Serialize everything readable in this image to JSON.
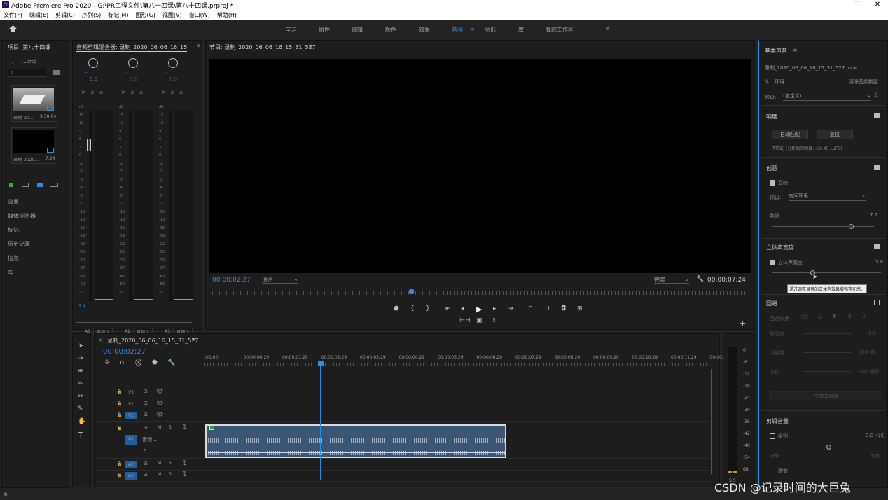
{
  "window": {
    "title": "Adobe Premiere Pro 2020 - G:\\PR工程文件\\第八十四课\\第八十四课.prproj *",
    "logo": "Pr",
    "minimize": "─",
    "maximize": "☐",
    "close": "✕"
  },
  "menu": [
    "文件(F)",
    "编辑(E)",
    "剪辑(C)",
    "序列(S)",
    "标记(M)",
    "图形(G)",
    "视图(V)",
    "窗口(W)",
    "帮助(H)"
  ],
  "workspace": {
    "tabs": [
      "学习",
      "组件",
      "编辑",
      "颜色",
      "效果",
      "音频",
      "图形",
      "库",
      "我的工作区"
    ],
    "active": "音频",
    "more": "»"
  },
  "project": {
    "title": "项目: 第八十四课",
    "file": "...proj",
    "items": [
      {
        "name": "录制_20...",
        "dur": "9:58:04"
      },
      {
        "name": "录制_2020...",
        "dur": "7:24"
      }
    ],
    "panels": [
      "效果",
      "媒体浏览器",
      "标记",
      "历史记录",
      "信息",
      "库"
    ]
  },
  "mixer": {
    "title": "音频剪辑混合器: 录制_2020_06_06_16_15",
    "lr": "L",
    "channels": [
      {
        "value": "0.0",
        "track": "A1",
        "name": "音频 1",
        "peak": "3.4"
      },
      {
        "value": "0.0",
        "track": "A2",
        "name": "音频 2",
        "peak": ""
      },
      {
        "value": "0.0",
        "track": "A3",
        "name": "音频 3",
        "peak": ""
      }
    ],
    "scale": [
      "dB",
      "15",
      "12",
      "9",
      "6",
      "3",
      "0",
      "-1",
      "-2",
      "-3",
      "-4",
      "-5",
      "-7",
      "-10",
      "-13",
      "-15",
      "-19",
      "-22",
      "-25",
      "-30",
      "-37",
      "-43",
      "-50",
      "-∞"
    ],
    "msb": [
      "M",
      "S",
      "⊙"
    ]
  },
  "program": {
    "title": "节目: 录制_2020_06_06_16_15_31_527",
    "timecode": "00;00;02;27",
    "fit": "适合",
    "quality": "完整",
    "duration": "00;00;07;24"
  },
  "timeline": {
    "tab": "录制_2020_06_06_16_15_31_527",
    "timecode": "00;00;02;27",
    "ruler": [
      ";00;00",
      "00;00;00;29",
      "00;00;01;29",
      "00;00;02;29",
      "00;00;03;29",
      "00;00;04;29",
      "00;00;05;29",
      "00;00;06;29",
      "00;00;07;29",
      "00;00;08;29",
      "00;00;09;29",
      "00;00;10;29",
      "00;00;11;29",
      "00;00;1"
    ],
    "tracks": [
      "V3",
      "V2",
      "V1",
      "A1",
      "A2",
      "A3"
    ],
    "a1name": "音频 1",
    "a1vol": "0.",
    "meterlabels": [
      "0",
      "-6",
      "-12",
      "-18",
      "-24",
      "-30",
      "-36",
      "-42",
      "-48",
      "-54",
      "dB"
    ],
    "ss": "S S"
  },
  "essential": {
    "title": "基本声音",
    "file": "录制_2020_06_06_16_15_31_527.mp4",
    "type": "环境",
    "clear": "清除音频类型",
    "preset_label": "预设:",
    "preset": "(自定义)",
    "loudness": "响度",
    "auto": "自动匹配",
    "reset": "复位",
    "loud_note": "不匹配 (分析后的响度: -30.45 LUFS)",
    "creative": "创意",
    "reverb": "混响",
    "reverb_preset_label": "预设:",
    "reverb_preset": "房间环境",
    "amount": "数量",
    "amount_val": "7.7",
    "stereo": "立体声宽度",
    "stereo_chk": "立体声宽度",
    "stereo_val": "3.8",
    "tooltip": "通过调整录音的立体声效果增强存在感。",
    "echo": "回避",
    "duck_against": "回避依据",
    "sensitivity": "敏感度",
    "duck_amount": "闪避量",
    "fade": "淡化",
    "gen": "生成关键帧",
    "v1": "6.0",
    "v2": "160 dB",
    "v3": "800 毫秒",
    "clipvol": "剪辑音量",
    "level": "级别",
    "level_val": "0.0",
    "level_unit": "分贝",
    "mute": "静音",
    "quiet": "安静",
    "loud": "响亮"
  },
  "watermark": "CSDN @记录时间的大巨兔",
  "colors": {
    "accent": "#2d8ceb",
    "bg": "#232323",
    "panel": "#1d1d1d",
    "clip": "#3b5574"
  }
}
